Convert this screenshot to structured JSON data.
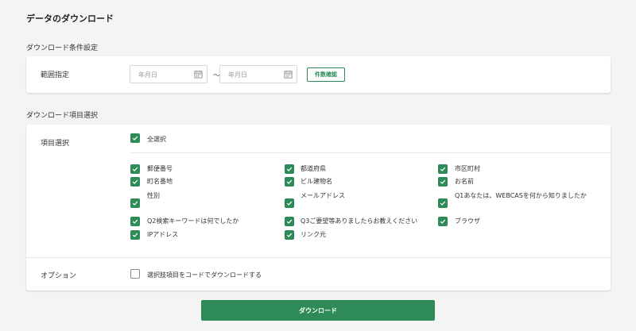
{
  "page": {
    "title": "データのダウンロード"
  },
  "conditions": {
    "section_title": "ダウンロード条件設定",
    "range_label": "範囲指定",
    "date_from_placeholder": "年月日",
    "date_to_placeholder": "年月日",
    "separator": "〜",
    "confirm_label": "件数確認"
  },
  "items": {
    "section_title": "ダウンロード項目選択",
    "row_label": "項目選択",
    "select_all": {
      "label": "全選択",
      "checked": true
    },
    "fields": [
      {
        "label": "郵便番号",
        "checked": true
      },
      {
        "label": "都道府県",
        "checked": true
      },
      {
        "label": "市区町村",
        "checked": true
      },
      {
        "label": "町名番地",
        "checked": true
      },
      {
        "label": "ビル建物名",
        "checked": true
      },
      {
        "label": "お名前",
        "checked": true
      },
      {
        "label": "性別",
        "checked": true
      },
      {
        "label": "メールアドレス",
        "checked": true
      },
      {
        "label": "Q1あなたは、WEBCASを何から知りましたか",
        "checked": true
      },
      {
        "label": "Q2検索キーワードは何でしたか",
        "checked": true
      },
      {
        "label": "Q3ご要望等ありましたらお教えください",
        "checked": true
      },
      {
        "label": "ブラウザ",
        "checked": true
      },
      {
        "label": "IPアドレス",
        "checked": true
      },
      {
        "label": "リンク元",
        "checked": true
      }
    ]
  },
  "options": {
    "row_label": "オプション",
    "code_download": {
      "label": "選択肢項目をコードでダウンロードする",
      "checked": false
    }
  },
  "actions": {
    "download_label": "ダウンロード"
  },
  "colors": {
    "accent": "#2e8b57",
    "background": "#f4f4f4",
    "card": "#ffffff"
  },
  "icons": {
    "date": "calendar-icon",
    "checked": "checkmark-icon"
  }
}
